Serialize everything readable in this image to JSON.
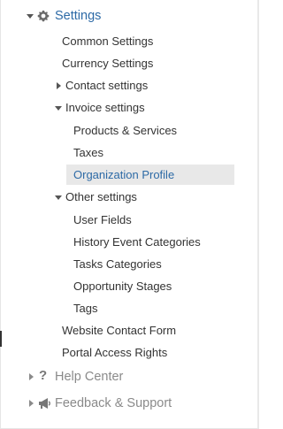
{
  "nav": {
    "settings": {
      "label": "Settings",
      "items": [
        {
          "label": "Common Settings"
        },
        {
          "label": "Currency Settings"
        },
        {
          "label": "Contact settings"
        },
        {
          "label": "Invoice settings",
          "items": [
            {
              "label": "Products & Services"
            },
            {
              "label": "Taxes"
            },
            {
              "label": "Organization Profile"
            }
          ]
        },
        {
          "label": "Other settings",
          "items": [
            {
              "label": "User Fields"
            },
            {
              "label": "History Event Categories"
            },
            {
              "label": "Tasks Categories"
            },
            {
              "label": "Opportunity Stages"
            },
            {
              "label": "Tags"
            }
          ]
        },
        {
          "label": "Website Contact Form"
        },
        {
          "label": "Portal Access Rights"
        }
      ]
    },
    "help_center": {
      "label": "Help Center"
    },
    "feedback": {
      "label": "Feedback & Support"
    }
  },
  "colors": {
    "selected_text": "#2d6aa6",
    "selected_bg": "#e8e8e8",
    "settings_title": "#2d6aa6",
    "muted_text": "#8a8a8a"
  }
}
